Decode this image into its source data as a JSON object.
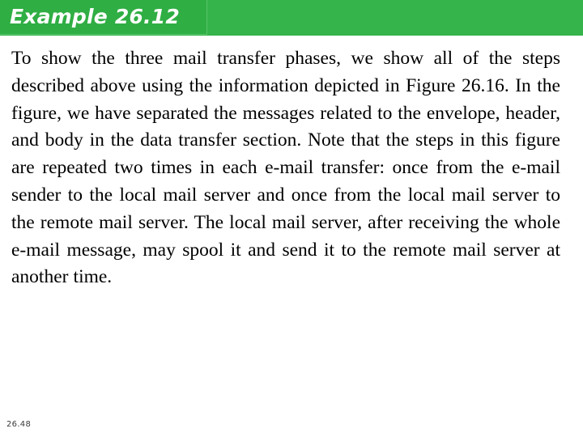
{
  "slide": {
    "title": "Example 26.12",
    "body": "To show the three mail transfer phases, we show all of the steps described above using the information depicted in Figure 26.16. In the figure, we have separated the messages related to the envelope, header, and body in the data transfer section. Note that the steps in this figure are repeated two times in each e-mail transfer: once from the e-mail sender to the local mail server and once from the local mail server to the remote mail server. The local mail server, after receiving the whole e-mail message, may spool it and send it to the remote mail server at another time.",
    "footer": "26.48",
    "colors": {
      "banner_green": "#34b44a",
      "title_box_green": "#2fae43",
      "title_text": "#ffffff",
      "body_text": "#000000",
      "footer_text": "#3a3a3a"
    }
  }
}
